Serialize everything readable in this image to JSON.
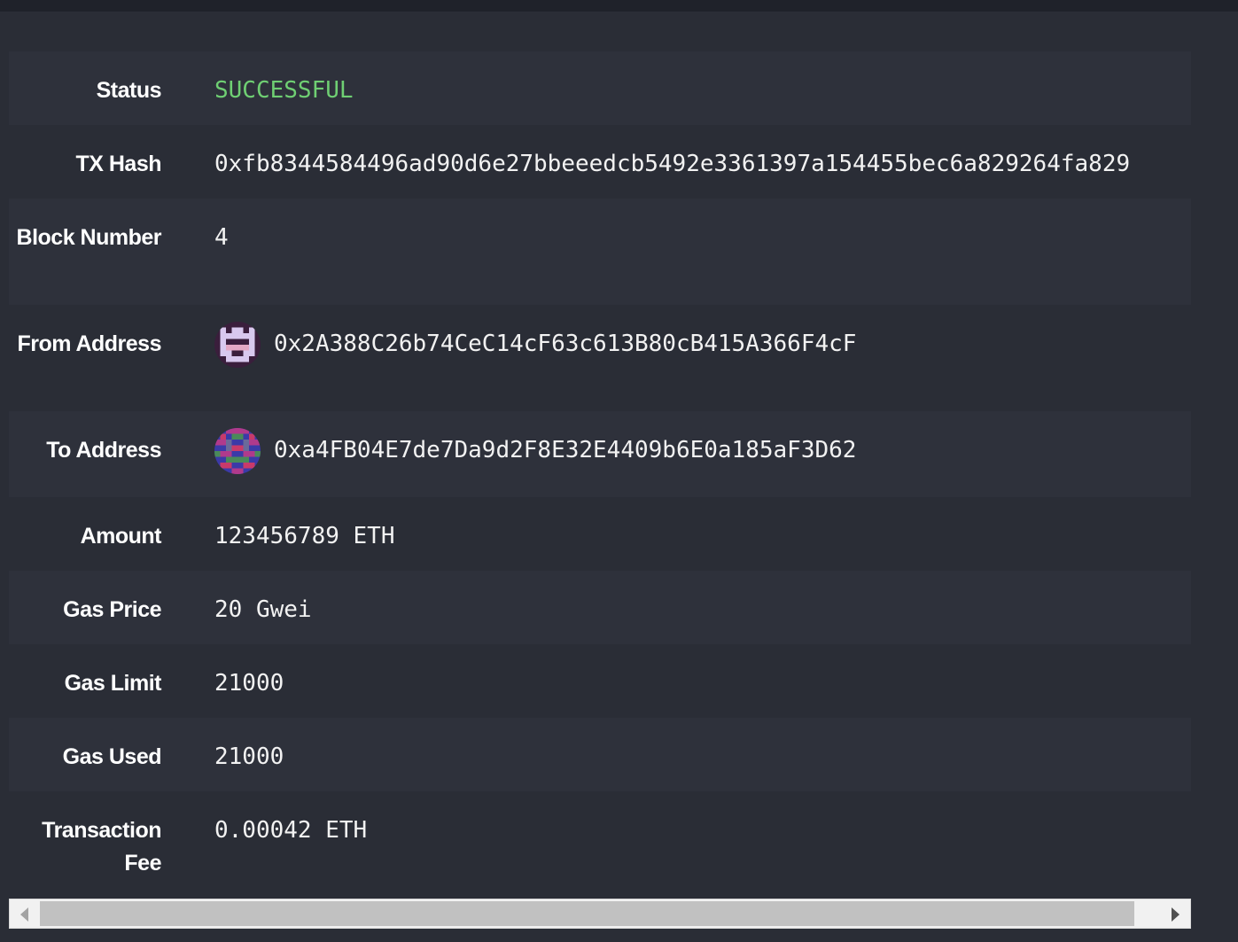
{
  "rows": [
    {
      "label": "Status",
      "value": "SUCCESSFUL"
    },
    {
      "label": "TX Hash",
      "value": "0xfb8344584496ad90d6e27bbeeedcb5492e3361397a154455bec6a829264fa829"
    },
    {
      "label": "Block Number",
      "value": "4"
    },
    {
      "label": "From Address",
      "value": "0x2A388C26b74CeC14cF63c613B80cB415A366F4cF"
    },
    {
      "label": "To Address",
      "value": "0xa4FB04E7de7Da9d2F8E32E4409b6E0a185aF3D62"
    },
    {
      "label": "Amount",
      "value": "123456789 ETH"
    },
    {
      "label": "Gas Price",
      "value": "20 Gwei"
    },
    {
      "label": "Gas Limit",
      "value": "21000"
    },
    {
      "label": "Gas Used",
      "value": "21000"
    },
    {
      "label": "Transaction Fee",
      "value": "0.00042 ETH"
    }
  ],
  "colors": {
    "status_success": "#6fcf73",
    "background": "#2a2d36",
    "row_alt": "#2e313b"
  },
  "icons": {
    "from_avatar": "identicon-avatar-from",
    "to_avatar": "identicon-avatar-to"
  }
}
